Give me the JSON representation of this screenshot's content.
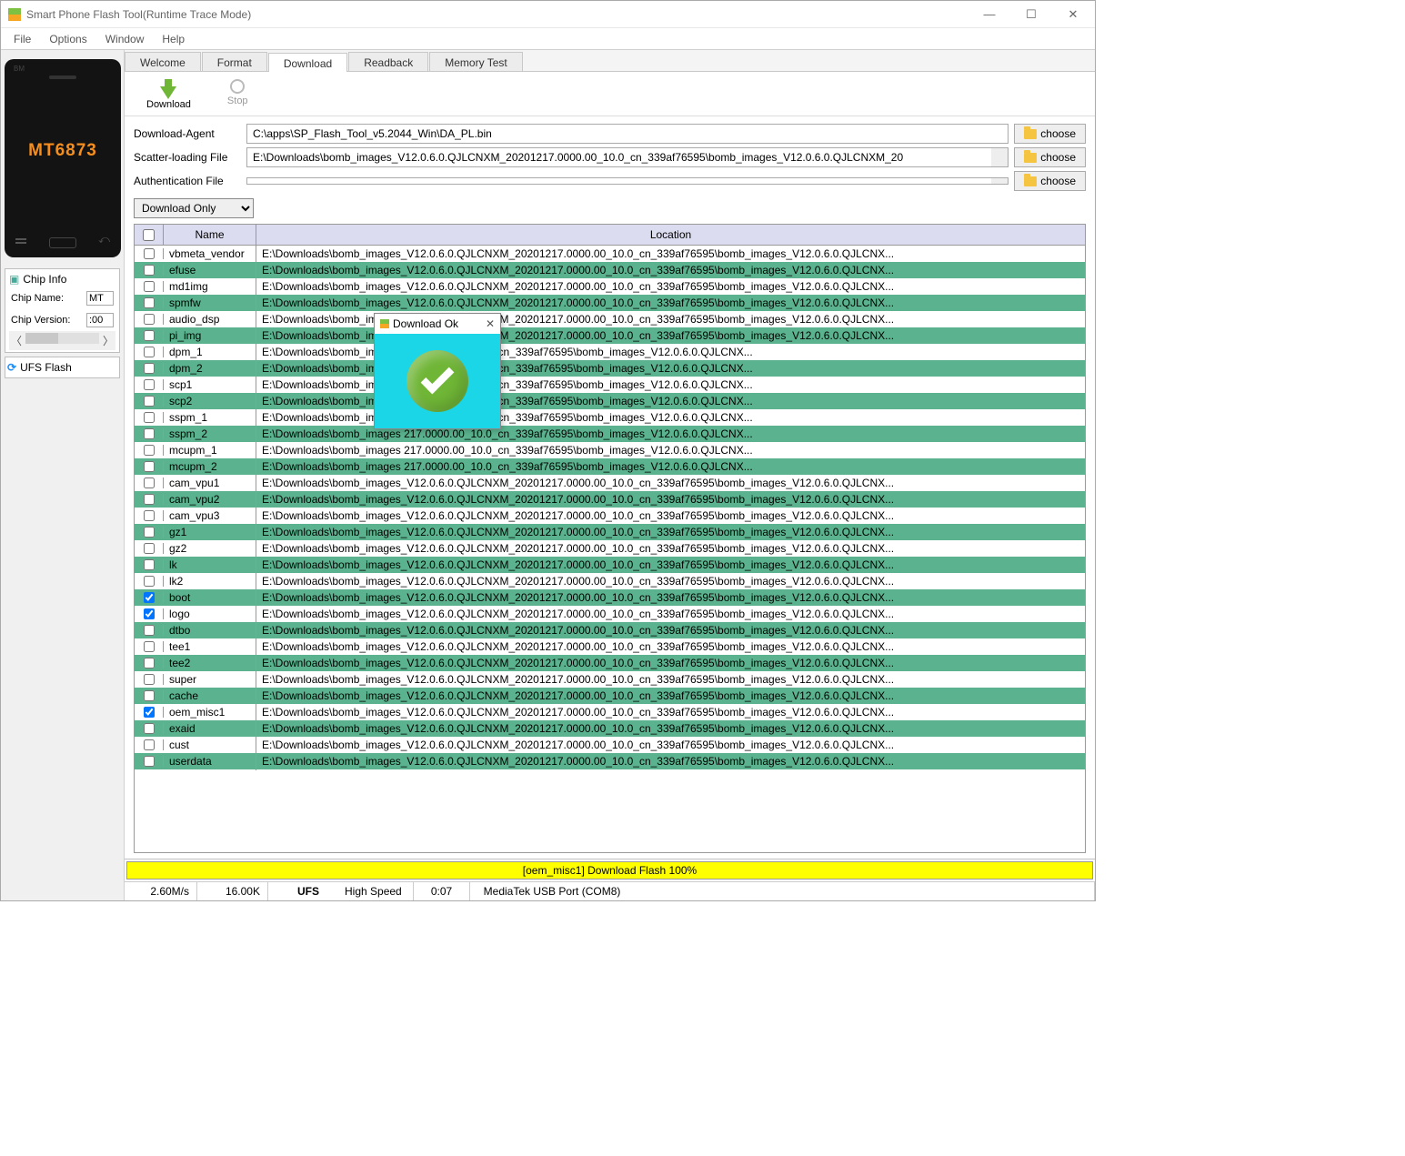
{
  "window": {
    "title": "Smart Phone Flash Tool(Runtime Trace Mode)"
  },
  "menu": {
    "file": "File",
    "options": "Options",
    "window": "Window",
    "help": "Help"
  },
  "phone": {
    "chip": "MT6873"
  },
  "chipinfo": {
    "header": "Chip Info",
    "name_label": "Chip Name:",
    "name_val": "MT",
    "ver_label": "Chip Version:",
    "ver_val": ":00"
  },
  "ufs": {
    "label": "UFS Flash"
  },
  "tabs": {
    "welcome": "Welcome",
    "format": "Format",
    "download": "Download",
    "readback": "Readback",
    "memtest": "Memory Test"
  },
  "toolbar": {
    "download": "Download",
    "stop": "Stop"
  },
  "form": {
    "da_label": "Download-Agent",
    "da_value": "C:\\apps\\SP_Flash_Tool_v5.2044_Win\\DA_PL.bin",
    "scatter_label": "Scatter-loading File",
    "scatter_value": "E:\\Downloads\\bomb_images_V12.0.6.0.QJLCNXM_20201217.0000.00_10.0_cn_339af76595\\bomb_images_V12.0.6.0.QJLCNXM_20",
    "auth_label": "Authentication File",
    "auth_value": "",
    "choose": "choose",
    "mode": "Download Only"
  },
  "table": {
    "col_name": "Name",
    "col_loc": "Location",
    "loc": "E:\\Downloads\\bomb_images_V12.0.6.0.QJLCNXM_20201217.0000.00_10.0_cn_339af76595\\bomb_images_V12.0.6.0.QJLCNX...",
    "loc_cut": "E:\\Downloads\\bomb_images",
    "loc_tail": "217.0000.00_10.0_cn_339af76595\\bomb_images_V12.0.6.0.QJLCNX...",
    "rows": [
      {
        "name": "vbmeta_vendor",
        "checked": false,
        "green": false
      },
      {
        "name": "efuse",
        "checked": false,
        "green": true
      },
      {
        "name": "md1img",
        "checked": false,
        "green": false
      },
      {
        "name": "spmfw",
        "checked": false,
        "green": true
      },
      {
        "name": "audio_dsp",
        "checked": false,
        "green": false
      },
      {
        "name": "pi_img",
        "checked": false,
        "green": true
      },
      {
        "name": "dpm_1",
        "checked": false,
        "green": false,
        "cut": true
      },
      {
        "name": "dpm_2",
        "checked": false,
        "green": true,
        "cut": true
      },
      {
        "name": "scp1",
        "checked": false,
        "green": false,
        "cut": true
      },
      {
        "name": "scp2",
        "checked": false,
        "green": true,
        "cut": true
      },
      {
        "name": "sspm_1",
        "checked": false,
        "green": false,
        "cut": true
      },
      {
        "name": "sspm_2",
        "checked": false,
        "green": true,
        "cut": true
      },
      {
        "name": "mcupm_1",
        "checked": false,
        "green": false,
        "cut": true
      },
      {
        "name": "mcupm_2",
        "checked": false,
        "green": true,
        "cut": true
      },
      {
        "name": "cam_vpu1",
        "checked": false,
        "green": false
      },
      {
        "name": "cam_vpu2",
        "checked": false,
        "green": true
      },
      {
        "name": "cam_vpu3",
        "checked": false,
        "green": false
      },
      {
        "name": "gz1",
        "checked": false,
        "green": true
      },
      {
        "name": "gz2",
        "checked": false,
        "green": false
      },
      {
        "name": "lk",
        "checked": false,
        "green": true
      },
      {
        "name": "lk2",
        "checked": false,
        "green": false
      },
      {
        "name": "boot",
        "checked": true,
        "green": true
      },
      {
        "name": "logo",
        "checked": true,
        "green": false
      },
      {
        "name": "dtbo",
        "checked": false,
        "green": true
      },
      {
        "name": "tee1",
        "checked": false,
        "green": false
      },
      {
        "name": "tee2",
        "checked": false,
        "green": true
      },
      {
        "name": "super",
        "checked": false,
        "green": false
      },
      {
        "name": "cache",
        "checked": false,
        "green": true
      },
      {
        "name": "oem_misc1",
        "checked": true,
        "green": false
      },
      {
        "name": "exaid",
        "checked": false,
        "green": true
      },
      {
        "name": "cust",
        "checked": false,
        "green": false
      },
      {
        "name": "userdata",
        "checked": false,
        "green": true
      }
    ]
  },
  "status": {
    "yellow": "[oem_misc1] Download Flash 100%",
    "speed": "2.60M/s",
    "size": "16.00K",
    "storage": "UFS",
    "speed_mode": "High Speed",
    "time": "0:07",
    "port": "MediaTek USB Port (COM8)"
  },
  "modal": {
    "title": "Download Ok"
  }
}
